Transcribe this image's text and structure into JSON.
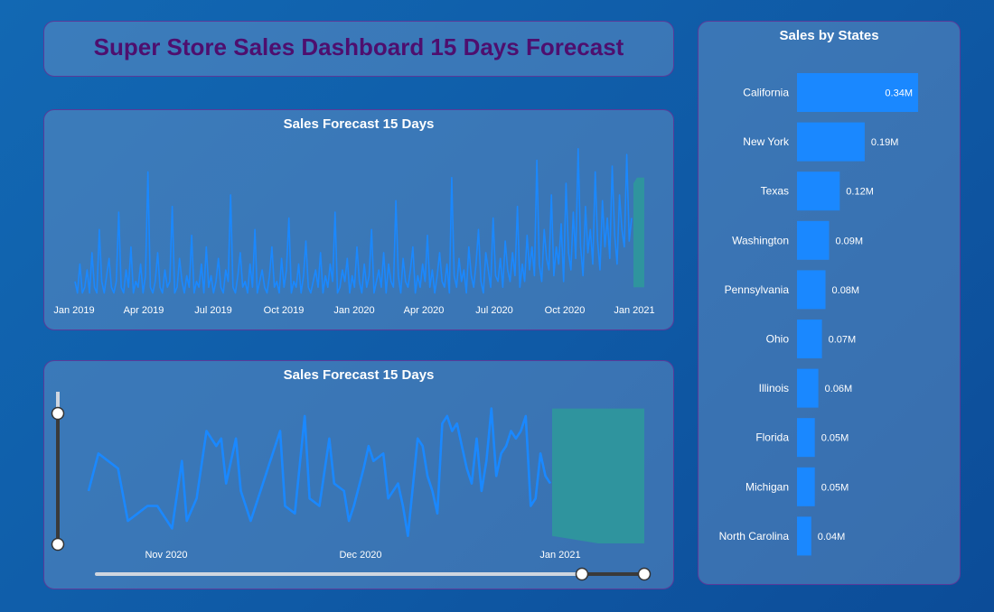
{
  "dashboard": {
    "title": "Super Store Sales Dashboard 15 Days Forecast"
  },
  "colors": {
    "title": "#4e0f6e",
    "line": "#1a88ff",
    "forecast_band": "#2e9a9a",
    "bar": "#1a88ff",
    "card_border": "#5a3a9a",
    "slider_track": "#cfd6e0"
  },
  "forecast_chart_full": {
    "title": "Sales Forecast 15 Days",
    "x_ticks": [
      "Jan 2019",
      "Apr 2019",
      "Jul 2019",
      "Oct 2019",
      "Jan 2020",
      "Apr 2020",
      "Jul 2020",
      "Oct 2020",
      "Jan 2021"
    ]
  },
  "forecast_chart_zoom": {
    "title": "Sales Forecast 15 Days",
    "x_ticks": [
      "Nov 2020",
      "Dec 2020",
      "Jan 2021"
    ],
    "horizontal_slider": {
      "start_fraction": 0.9,
      "end_fraction": 1.0
    },
    "vertical_slider": {
      "start_fraction": 0.0,
      "end_fraction": 1.0
    }
  },
  "states_chart": {
    "title": "Sales by States"
  },
  "chart_data": [
    {
      "type": "line",
      "title": "Sales Forecast 15 Days",
      "x_ticks": [
        "Jan 2019",
        "Apr 2019",
        "Jul 2019",
        "Oct 2019",
        "Jan 2020",
        "Apr 2020",
        "Jul 2020",
        "Oct 2020",
        "Jan 2021"
      ],
      "x_range": [
        "2019-01-01",
        "2021-01-15"
      ],
      "forecast_window": [
        "2020-12-31",
        "2021-01-15"
      ],
      "series": [
        {
          "values": [
            3,
            1,
            6,
            1,
            2,
            5,
            1,
            8,
            2,
            1,
            12,
            3,
            1,
            4,
            7,
            2,
            1,
            3,
            15,
            2,
            1,
            5,
            2,
            9,
            1,
            3,
            2,
            6,
            1,
            4,
            22,
            2,
            1,
            3,
            8,
            2,
            1,
            5,
            2,
            3,
            16,
            1,
            2,
            7,
            3,
            1,
            4,
            2,
            11,
            1,
            3,
            2,
            6,
            1,
            9,
            2,
            4,
            1,
            3,
            7,
            2,
            1,
            5,
            3,
            18,
            2,
            1,
            4,
            8,
            2,
            3,
            1,
            6,
            2,
            12,
            1,
            3,
            5,
            2,
            1,
            4,
            9,
            2,
            3,
            1,
            7,
            2,
            5,
            14,
            1,
            3,
            2,
            6,
            1,
            4,
            10,
            2,
            1,
            3,
            5,
            2,
            8,
            1,
            4,
            2,
            6,
            3,
            15,
            1,
            2,
            5,
            3,
            7,
            1,
            4,
            2,
            9,
            3,
            1,
            6,
            2,
            4,
            12,
            1,
            3,
            5,
            2,
            8,
            1,
            6,
            3,
            2,
            17,
            4,
            1,
            7,
            3,
            2,
            5,
            9,
            1,
            4,
            2,
            6,
            3,
            11,
            2,
            5,
            1,
            4,
            8,
            3,
            2,
            6,
            1,
            21,
            4,
            2,
            7,
            3,
            5,
            1,
            9,
            4,
            2,
            6,
            12,
            3,
            1,
            8,
            5,
            2,
            14,
            4,
            3,
            7,
            2,
            10,
            5,
            3,
            8,
            4,
            16,
            2,
            6,
            3,
            11,
            5,
            9,
            4,
            24,
            6,
            3,
            12,
            7,
            5,
            18,
            4,
            9,
            6,
            13,
            3,
            20,
            8,
            5,
            15,
            7,
            26,
            9,
            4,
            16,
            8,
            12,
            6,
            22,
            10,
            5,
            17,
            9,
            14,
            7,
            23,
            11,
            6,
            18,
            12,
            9,
            25,
            10,
            14
          ]
        }
      ],
      "forecast_band": {
        "lower": [
          2,
          2,
          2,
          2
        ],
        "upper": [
          20,
          21,
          21,
          21
        ]
      },
      "ylim": [
        0,
        28
      ]
    },
    {
      "type": "line",
      "title": "Sales Forecast 15 Days",
      "x_ticks": [
        "Nov 2020",
        "Dec 2020",
        "Jan 2021"
      ],
      "x_range": [
        "2020-10-17",
        "2021-01-15"
      ],
      "forecast_window": [
        "2020-12-31",
        "2021-01-15"
      ],
      "series": [
        {
          "values": [
            7,
            12,
            11,
            10,
            3,
            4,
            5,
            5,
            4,
            2,
            11,
            3,
            6,
            15,
            13,
            14,
            8,
            14,
            7,
            3,
            7,
            11,
            15,
            5,
            4,
            17,
            6,
            5,
            14,
            8,
            7,
            3,
            5,
            10,
            13,
            11,
            12,
            6,
            8,
            5,
            1,
            14,
            13,
            9,
            7,
            4,
            16,
            17,
            15,
            16,
            13,
            10,
            8,
            14,
            7,
            11,
            18,
            9,
            12,
            13,
            15,
            14,
            15,
            17,
            5,
            6,
            12,
            9,
            8
          ],
          "x_days_from_start": [
            0,
            2,
            4,
            6,
            8,
            10,
            12,
            14,
            15,
            17,
            19,
            20,
            22,
            24,
            26,
            27,
            28,
            30,
            31,
            33,
            35,
            37,
            39,
            40,
            42,
            44,
            45,
            47,
            49,
            50,
            52,
            53,
            54,
            56,
            57,
            58,
            60,
            61,
            63,
            64,
            65,
            67,
            68,
            69,
            70,
            71,
            72,
            73,
            74,
            75,
            76,
            77,
            78,
            79,
            80,
            81,
            82,
            83,
            84,
            85,
            86,
            87,
            88,
            89,
            90,
            91,
            92,
            93,
            94
          ]
        }
      ],
      "forecast_band": {
        "lower": [
          1,
          0,
          0
        ],
        "upper": [
          18,
          18,
          18
        ]
      },
      "ylim": [
        0,
        20
      ]
    },
    {
      "type": "bar",
      "orientation": "horizontal",
      "title": "Sales by States",
      "categories": [
        "California",
        "New York",
        "Texas",
        "Washington",
        "Pennsylvania",
        "Ohio",
        "Illinois",
        "Florida",
        "Michigan",
        "North Carolina"
      ],
      "values": [
        0.34,
        0.19,
        0.12,
        0.09,
        0.08,
        0.07,
        0.06,
        0.05,
        0.05,
        0.04
      ],
      "labels": [
        "0.34M",
        "0.19M",
        "0.12M",
        "0.09M",
        "0.08M",
        "0.07M",
        "0.06M",
        "0.05M",
        "0.05M",
        "0.04M"
      ],
      "unit": "M"
    }
  ]
}
